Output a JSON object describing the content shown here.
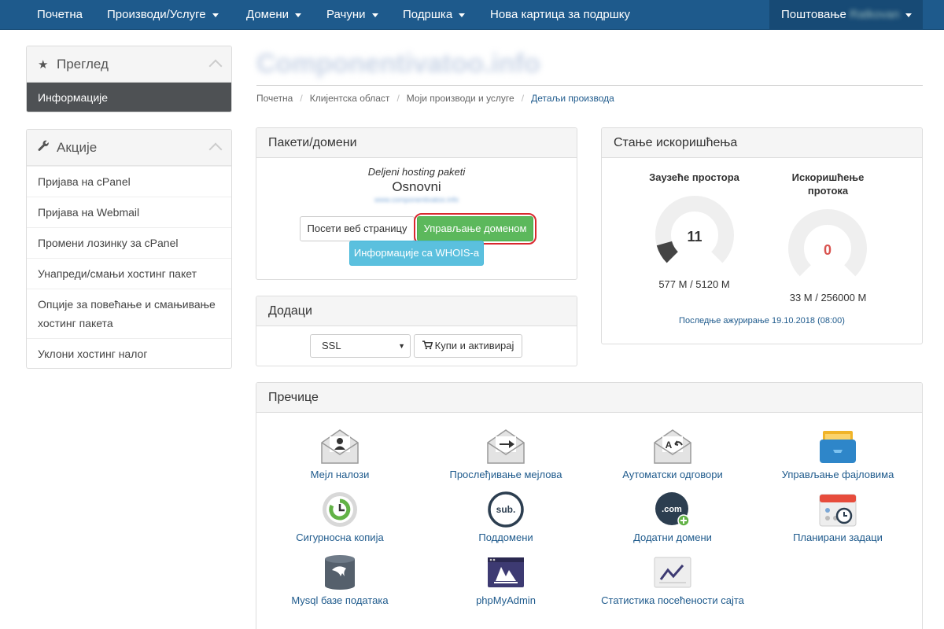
{
  "nav": {
    "home": "Почетна",
    "products": "Производи/Услуге",
    "domains": "Домени",
    "billing": "Рачуни",
    "support": "Подршка",
    "new_ticket": "Нова картица за подршку",
    "greeting": "Поштовање",
    "user_name": "Ratkovan"
  },
  "sidebar": {
    "overview_title": "Преглед",
    "overview_active": "Информације",
    "actions_title": "Акције",
    "actions": [
      "Пријава на cPanel",
      "Пријава на Webmail",
      "Промени лозинку за cPanel",
      "Унапреди/смањи хостинг пакет",
      "Опције за повећање и смањивање хостинг пакета",
      "Уклони хостинг налог"
    ]
  },
  "page": {
    "title": "Componentivatoo.info",
    "breadcrumb": [
      "Почетна",
      "Клијентска област",
      "Моји производи и услуге",
      "Детаљи производа"
    ]
  },
  "package": {
    "header": "Пакети/домени",
    "group": "Deljeni hosting paketi",
    "name": "Osnovni",
    "domain": "www.componentivatoo.info",
    "visit_btn": "Посети веб страницу",
    "manage_btn": "Управљање доменом",
    "whois_btn": "Информације са WHOIS-а"
  },
  "addons": {
    "header": "Додаци",
    "selected": "SSL",
    "buy_btn": "Купи и активирај"
  },
  "usage": {
    "header": "Стање искоришћења",
    "disk_title": "Заузеће простора",
    "disk_value": "11",
    "disk_percent": 11,
    "disk_text": "577 M / 5120 M",
    "bw_title_1": "Искоришћење",
    "bw_title_2": "протока",
    "bw_value": "0",
    "bw_percent": 0,
    "bw_text": "33 M / 256000 M",
    "updated": "Последње ажурирање 19.10.2018 (08:00)"
  },
  "shortcuts": {
    "header": "Пречице",
    "items": [
      {
        "label": "Мејл налози",
        "icon": "email-accounts-icon"
      },
      {
        "label": "Прослеђивање мејлова",
        "icon": "email-forwarders-icon"
      },
      {
        "label": "Аутоматски одговори",
        "icon": "autoresponders-icon"
      },
      {
        "label": "Управљање фајловима",
        "icon": "file-manager-icon"
      },
      {
        "label": "Сигурносна копија",
        "icon": "backup-icon"
      },
      {
        "label": "Поддомени",
        "icon": "subdomains-icon"
      },
      {
        "label": "Додатни домени",
        "icon": "addon-domains-icon"
      },
      {
        "label": "Планирани задаци",
        "icon": "cron-jobs-icon"
      },
      {
        "label": "Mysql базе података",
        "icon": "mysql-icon"
      },
      {
        "label": "phpMyAdmin",
        "icon": "phpmyadmin-icon"
      },
      {
        "label": "Статистика посећености сајта",
        "icon": "site-stats-icon"
      }
    ]
  },
  "colors": {
    "nav": "#1e5a8c",
    "accent_green": "#5cb85c",
    "info_blue": "#5bc0de",
    "danger": "#d9534f"
  }
}
